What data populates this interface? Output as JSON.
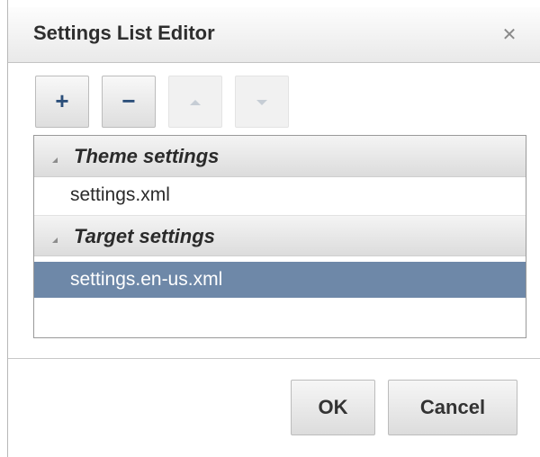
{
  "dialog": {
    "title": "Settings List Editor",
    "close_icon": "close-icon"
  },
  "toolbar": {
    "add_label": "+",
    "remove_label": "−",
    "move_up_icon": "triangle-up-icon",
    "move_down_icon": "triangle-down-icon"
  },
  "list": {
    "groups": [
      {
        "label": "Theme settings",
        "items": [
          {
            "label": "settings.xml",
            "selected": false
          }
        ]
      },
      {
        "label": "Target settings",
        "items": [
          {
            "label": "settings.en-us.xml",
            "selected": true
          }
        ]
      }
    ]
  },
  "footer": {
    "ok_label": "OK",
    "cancel_label": "Cancel"
  },
  "colors": {
    "selection": "#6e88a8",
    "icon_accent": "#2c4f7a"
  }
}
